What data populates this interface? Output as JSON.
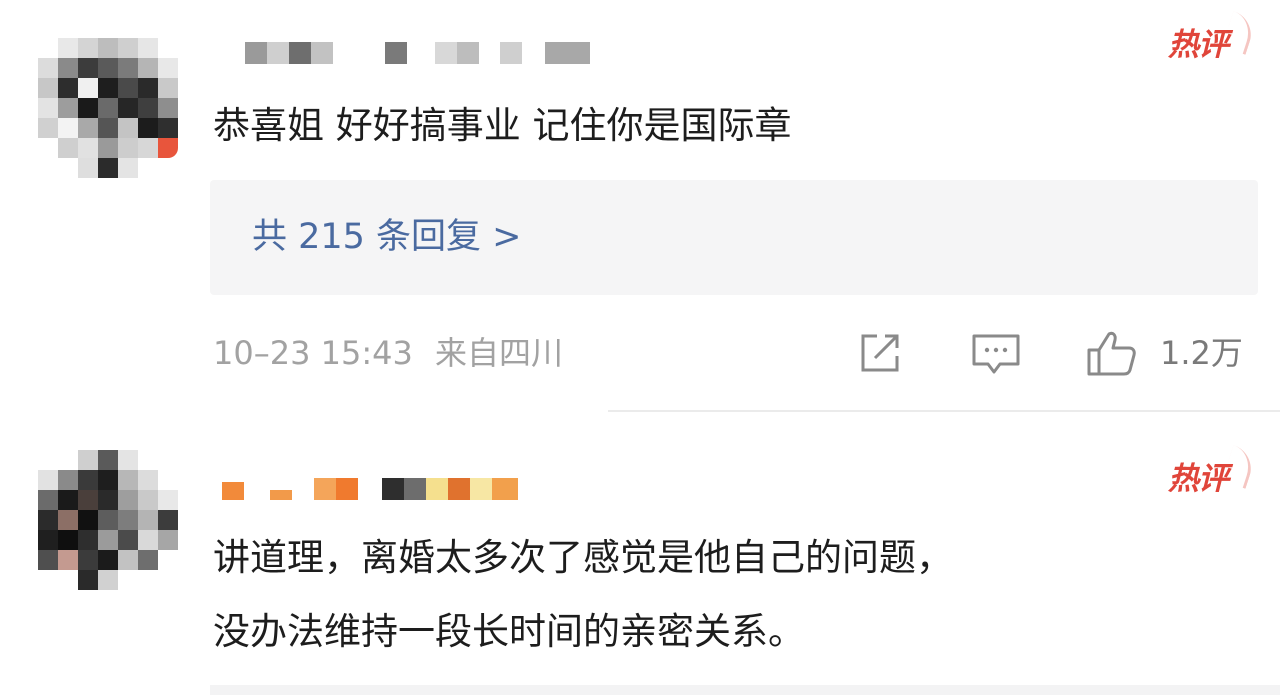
{
  "comments": [
    {
      "hot_label": "热评",
      "text": "恭喜姐 好好搞事业 记住你是国际章",
      "reply_link": "共 215 条回复 >",
      "timestamp": "10–23 15:43",
      "location": "来自四川",
      "likes": "1.2万"
    },
    {
      "hot_label": "热评",
      "text_line1": "讲道理，离婚太多次了感觉是他自己的问题，",
      "text_line2": "没办法维持一段长时间的亲密关系。"
    }
  ],
  "colors": {
    "hot": "#e0453a",
    "link": "#4a6aa0",
    "meta": "#a2a2a2",
    "reply_bg": "#f5f5f6"
  },
  "icons": {
    "share": "share-icon",
    "comment": "comment-icon",
    "like": "thumbs-up-icon"
  }
}
